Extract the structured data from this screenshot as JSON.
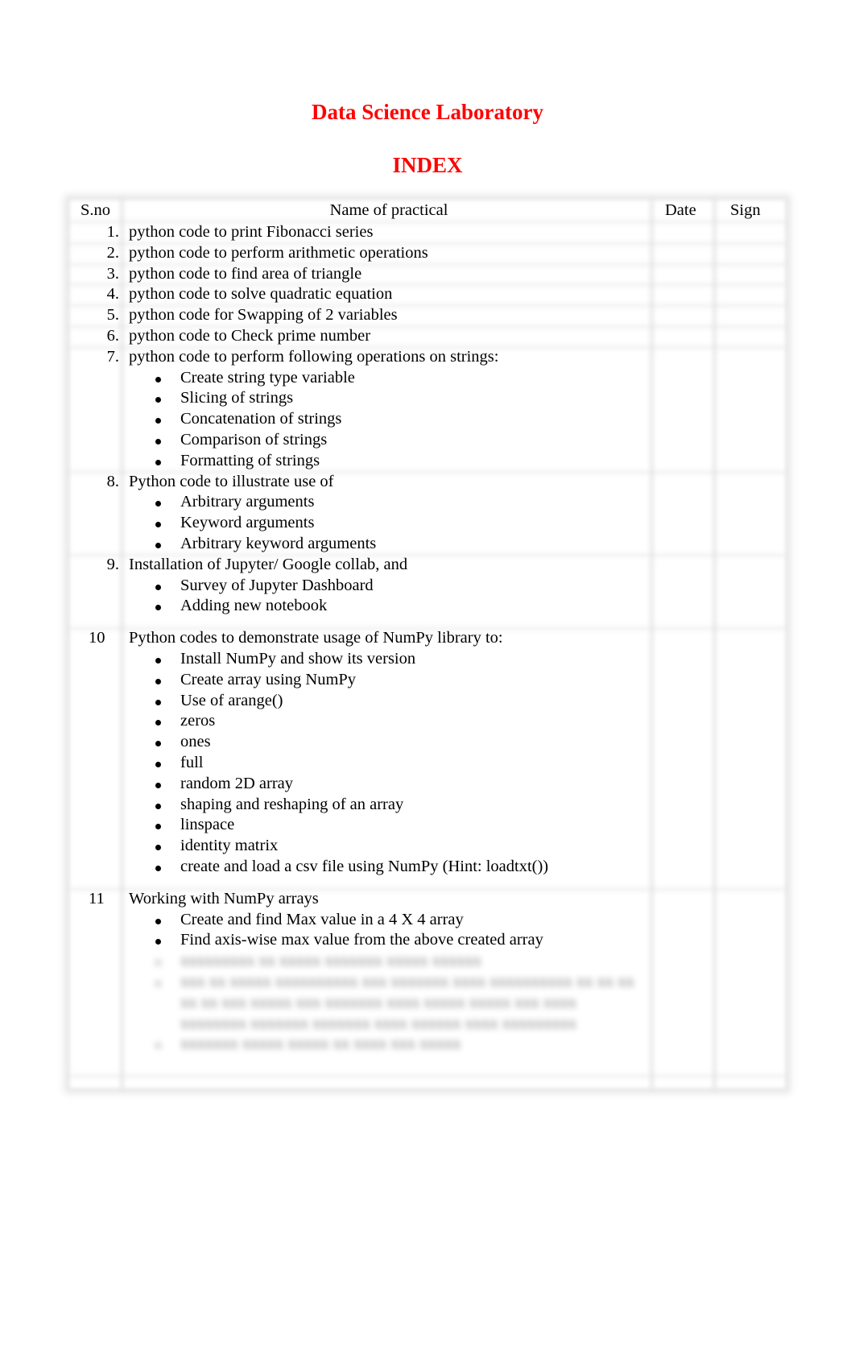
{
  "document": {
    "title": "Data Science Laboratory",
    "subtitle": "INDEX",
    "accent_color": "#ff0000"
  },
  "table": {
    "headers": {
      "sno": "S.no",
      "name": "Name of practical",
      "date": "Date",
      "sign": "Sign"
    },
    "rows": [
      {
        "sno": "1.",
        "name": "python code to print Fibonacci series",
        "sub": []
      },
      {
        "sno": "2.",
        "name": "python code to perform arithmetic operations",
        "sub": []
      },
      {
        "sno": "3.",
        "name": "python code to find area of triangle",
        "sub": []
      },
      {
        "sno": "4.",
        "name": "python code to solve quadratic equation",
        "sub": []
      },
      {
        "sno": "5.",
        "name": "python code for Swapping of 2 variables",
        "sub": []
      },
      {
        "sno": "6.",
        "name": "python code to Check prime number",
        "sub": []
      },
      {
        "sno": "7.",
        "name": "python code to perform following operations on strings:",
        "sub": [
          "Create string type variable",
          "Slicing of strings",
          "Concatenation of strings",
          "Comparison of strings",
          "Formatting of strings"
        ]
      },
      {
        "sno": "8.",
        "name": "Python code to illustrate use of",
        "sub": [
          "Arbitrary arguments",
          "Keyword arguments",
          "Arbitrary keyword arguments"
        ]
      },
      {
        "sno": "9.",
        "name": "Installation of Jupyter/ Google collab, and",
        "sub": [
          "Survey of Jupyter Dashboard",
          "Adding new notebook"
        ]
      },
      {
        "sno": "10",
        "name": "Python codes to demonstrate usage of NumPy library to:",
        "sub": [
          "Install NumPy and show its version",
          "Create array using NumPy",
          "Use of arange()",
          "zeros",
          "ones",
          "full",
          "random 2D array",
          "shaping and reshaping of an array",
          "linspace",
          "identity matrix",
          "create and load a csv file using NumPy (Hint: loadtxt())"
        ]
      },
      {
        "sno": "11",
        "name": "Working with NumPy arrays",
        "sub": [
          "Create and find Max value in a 4 X 4 array",
          "Find axis-wise max value from the above created array"
        ],
        "blurred_sub": [
          "xxxxxxxxx xx xxxxx xxxxxxx xxxxx xxxxxx",
          "xxx xx xxxxx xxxxxxxxxx xxx xxxxxxx xxxx xxxxxxxxxx xx xx xx",
          "xx xx xxx xxxxx xxx xxxxxxx xxxx xxxxx xxxxx xxx xxxx",
          "xxxxxxxx xxxxxxx xxxxxxx xxxx xxxxxx xxxx xxxxxxxxx",
          "xxxxxxx xxxxx xxxxx xx xxxx xxx xxxxx"
        ]
      }
    ]
  }
}
